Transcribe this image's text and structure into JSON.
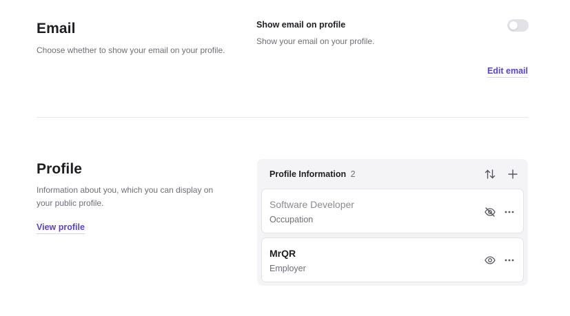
{
  "email": {
    "title": "Email",
    "description": "Choose whether to show your email on your profile.",
    "toggle_label": "Show email on profile",
    "toggle_description": "Show your email on your profile.",
    "toggle_on": false,
    "edit_link": "Edit email"
  },
  "profile": {
    "title": "Profile",
    "description_line1": "Information about you, which you can display on",
    "description_line2": "your public profile.",
    "view_link": "View profile",
    "panel": {
      "title": "Profile Information",
      "count": "2",
      "items": [
        {
          "value": "Software Developer",
          "label": "Occupation",
          "visible": false,
          "visibility_icon": "eye-off-icon"
        },
        {
          "value": "MrQR",
          "label": "Employer",
          "visible": true,
          "visibility_icon": "eye-icon"
        }
      ]
    }
  },
  "colors": {
    "accent": "#5b3fd6",
    "muted_text": "#6e6e78",
    "panel_bg": "#f4f4f6"
  }
}
